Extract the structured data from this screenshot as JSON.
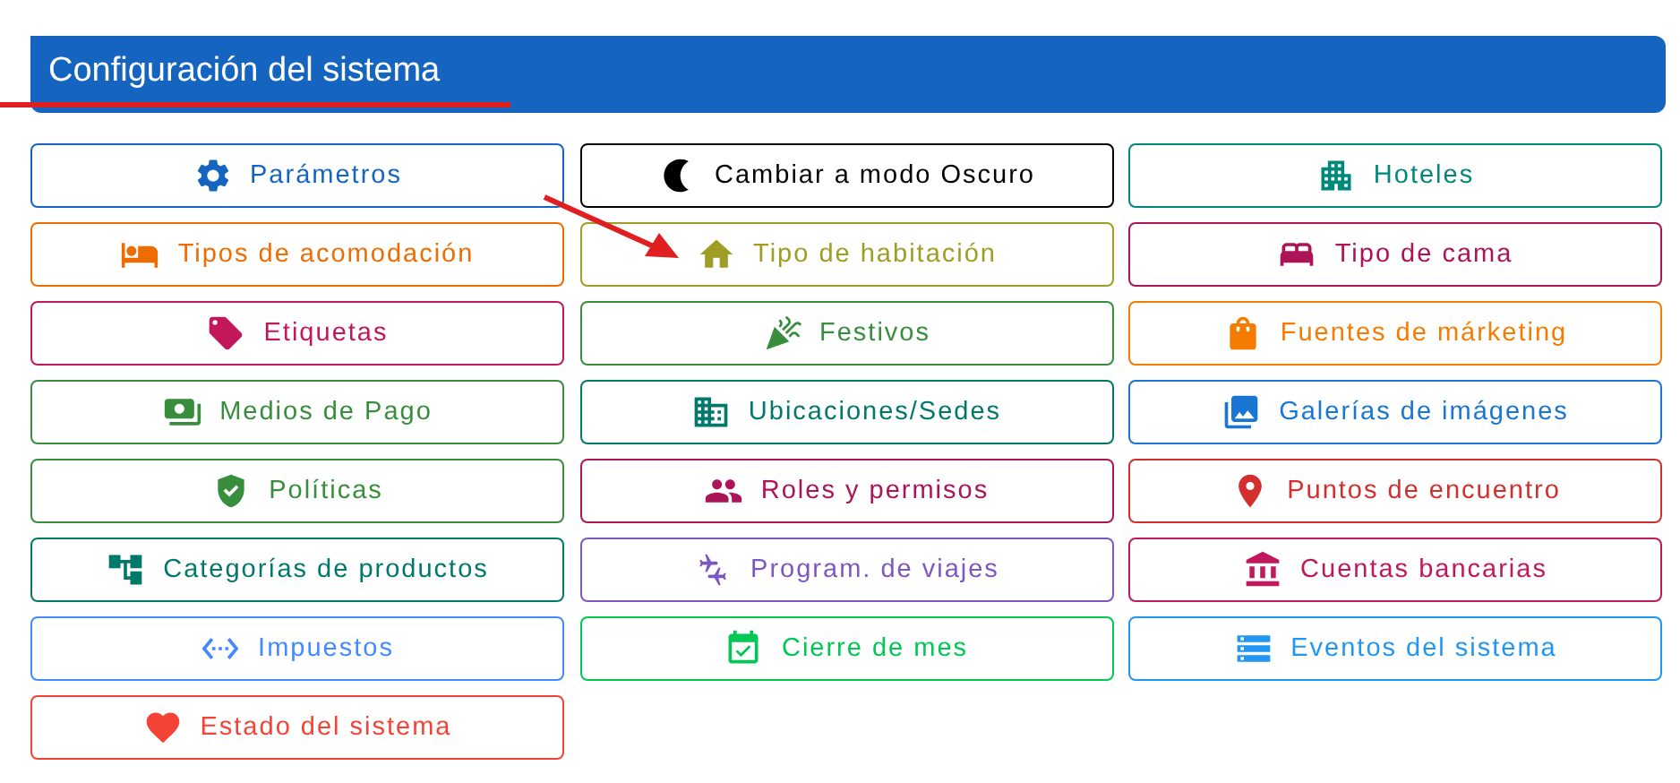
{
  "header": {
    "title": "Configuración del sistema"
  },
  "buttons": [
    {
      "label": "Parámetros",
      "color": "#1565c0"
    },
    {
      "label": "Cambiar a modo Oscuro",
      "color": "#000000"
    },
    {
      "label": "Hoteles",
      "color": "#00897b"
    },
    {
      "label": "Tipos de acomodación",
      "color": "#ef6c00"
    },
    {
      "label": "Tipo de habitación",
      "color": "#9e9d24"
    },
    {
      "label": "Tipo de cama",
      "color": "#ad1457"
    },
    {
      "label": "Etiquetas",
      "color": "#c2185b"
    },
    {
      "label": "Festivos",
      "color": "#388e3c"
    },
    {
      "label": "Fuentes de márketing",
      "color": "#f57c00"
    },
    {
      "label": "Medios de Pago",
      "color": "#388e3c"
    },
    {
      "label": "Ubicaciones/Sedes",
      "color": "#00796b"
    },
    {
      "label": "Galerías de imágenes",
      "color": "#1976d2"
    },
    {
      "label": "Políticas",
      "color": "#388e3c"
    },
    {
      "label": "Roles y permisos",
      "color": "#ad1457"
    },
    {
      "label": "Puntos de encuentro",
      "color": "#d32f2f"
    },
    {
      "label": "Categorías de productos",
      "color": "#00796b"
    },
    {
      "label": "Program. de viajes",
      "color": "#7e57c2"
    },
    {
      "label": "Cuentas bancarias",
      "color": "#c2185b"
    },
    {
      "label": "Impuestos",
      "color": "#448aff"
    },
    {
      "label": "Cierre de mes",
      "color": "#00c853"
    },
    {
      "label": "Eventos del sistema",
      "color": "#2196f3"
    },
    {
      "label": "Estado del sistema",
      "color": "#f44336"
    }
  ]
}
